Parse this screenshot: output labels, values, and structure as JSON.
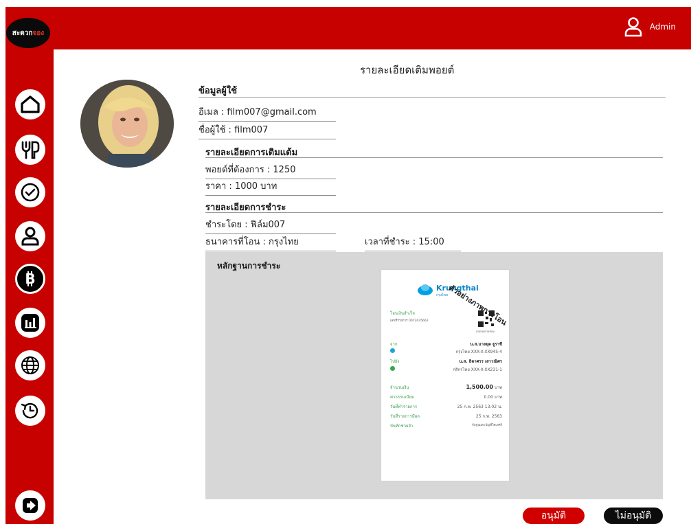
{
  "app": {
    "logo_text_a": "สะดวก",
    "logo_text_b": "จอง"
  },
  "header": {
    "user_label": "Admin"
  },
  "sidebar": {
    "items": [
      {
        "icon": "home-icon"
      },
      {
        "icon": "restaurant-icon"
      },
      {
        "icon": "check-icon"
      },
      {
        "icon": "user-icon"
      },
      {
        "icon": "bitcoin-icon"
      },
      {
        "icon": "chart-icon"
      },
      {
        "icon": "globe-icon"
      },
      {
        "icon": "history-icon"
      }
    ],
    "logout_icon": "logout-icon"
  },
  "page": {
    "title": "รายละเอียดเติมพอยต์"
  },
  "user_section": {
    "title": "ข้อมูลผู้ใช้",
    "email": "อีเมล :  film007@gmail.com",
    "username": "ชื่อผู้ใช้ : film007"
  },
  "topup_section": {
    "title": "รายละเอียดการเติมแต้ม",
    "points": "พอยต์ที่ต้องการ :  1250",
    "price": "ราคา :  1000 บาท"
  },
  "payment_section": {
    "title": "รายละเอียดการชำระ",
    "paid_by": "ชำระโดย :  ฟิล์ม007",
    "bank": "ธนาคารที่โอน : กรุงไทย",
    "time": "เวลาที่ชำระ : 15:00"
  },
  "proof": {
    "title": "หลักฐานการชำระ",
    "watermark": "ตัวอย่างภาพการโอน",
    "receipt": {
      "bank_name": "Krungthai",
      "bank_name_th": "กรุงไทย",
      "status": "โอนเงินสำเร็จ",
      "ref": "เลขที่รายการ 0073035662",
      "scan_label": "สแกนตรวจสอบ",
      "from_label": "จาก",
      "from_name": "น.ส.มาลยุต ฐูราชี",
      "from_acct": "กรุงไทย XXX-X-XX945-4",
      "to_label": "ไปยัง",
      "to_name": "น.ส. ธิดาศรร เสาวณิศร",
      "to_acct": "กสิกรไทย XXX-X-XX231-1",
      "amount_label": "จำนวนเงิน",
      "amount": "1,500.00",
      "amount_unit": "บาท",
      "fee_label": "ค่าธรรมเนียม",
      "fee": "0.00",
      "date_label": "วันที่ทำรายการ",
      "date": "25 ก.พ. 2563 13:02 น.",
      "eff_label": "วันที่รายการมีผล",
      "eff_date": "25 ก.พ. 2563",
      "memo_label": "บันทึกช่วยจำ",
      "memo": "จับจูนแตะบัญชีวิลเลศร์"
    }
  },
  "actions": {
    "approve": "อนุมัติ",
    "reject": "ไม่อนุมัติ"
  },
  "colors": {
    "brand_red": "#c70000",
    "approve": "#d00000",
    "reject": "#0c0c0c",
    "proof_bg": "#d7d7d7"
  }
}
